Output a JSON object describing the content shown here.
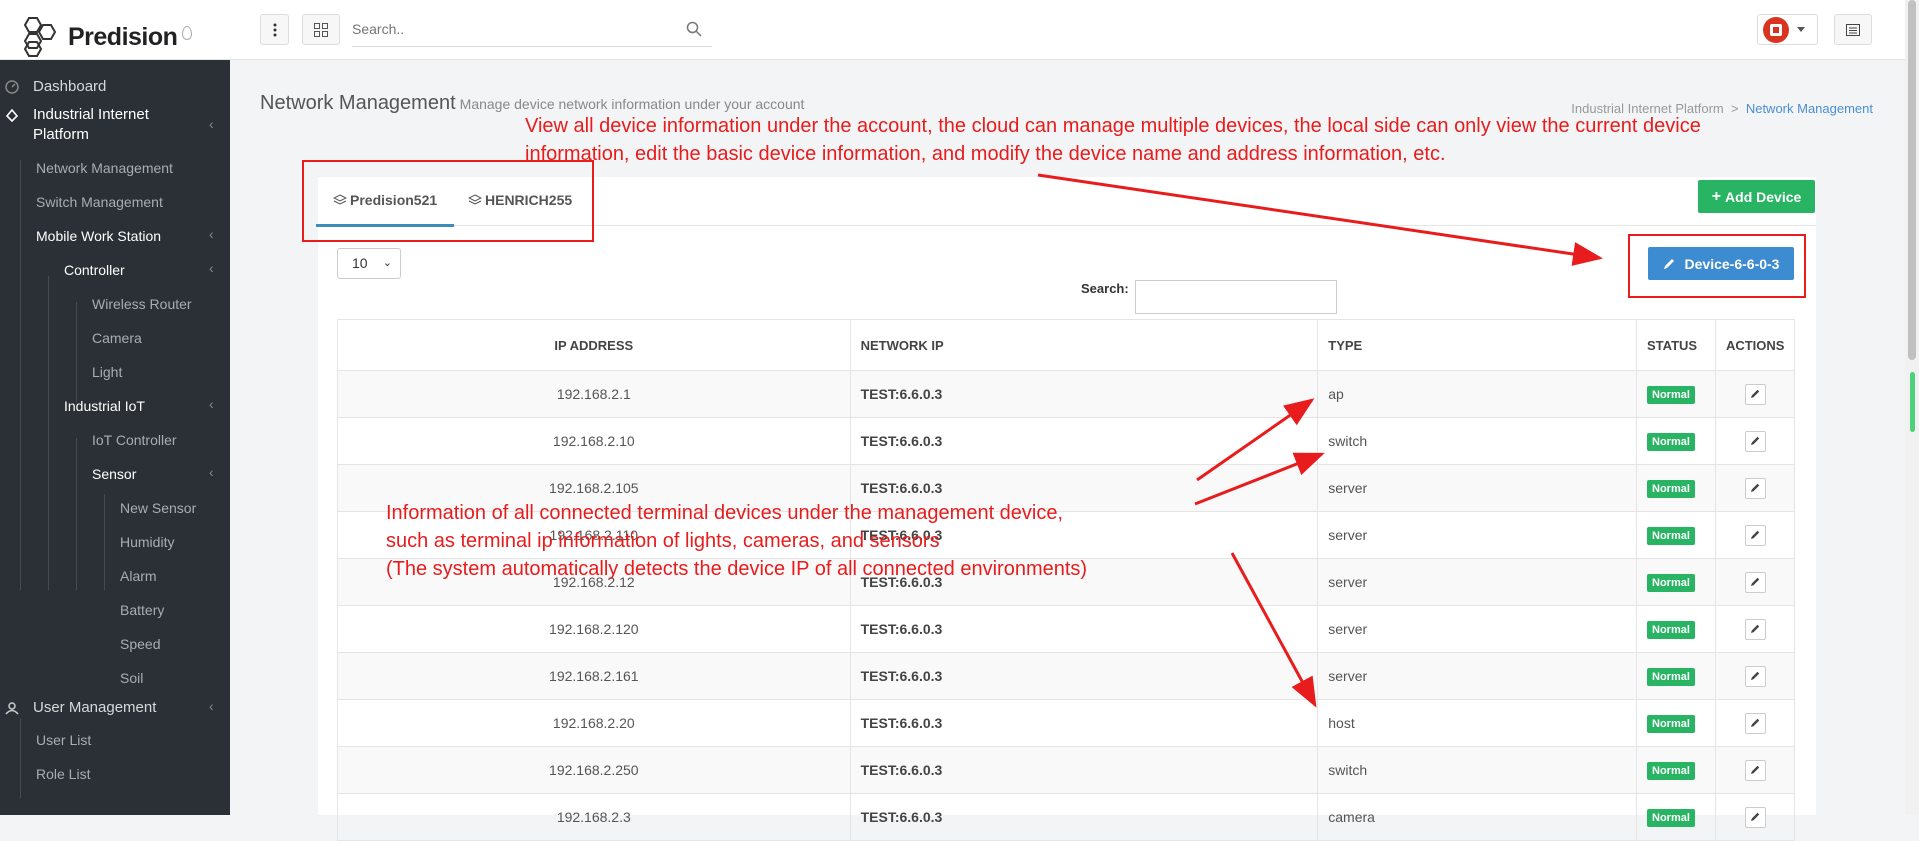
{
  "brand": {
    "name": "Predision"
  },
  "topbar": {
    "search_placeholder": "Search.."
  },
  "sidebar": {
    "dashboard": "Dashboard",
    "industrial_internet": "Industrial Internet Platform",
    "industrial_internet_line1": "Industrial Internet",
    "industrial_internet_line2": "Platform",
    "network_management": "Network Management",
    "switch_management": "Switch Management",
    "mobile_work_station": "Mobile Work Station",
    "controller": "Controller",
    "wireless_router": "Wireless Router",
    "camera": "Camera",
    "light": "Light",
    "industrial_iot": "Industrial IoT",
    "iot_controller": "IoT Controller",
    "sensor": "Sensor",
    "new_sensor": "New Sensor",
    "humidity": "Humidity",
    "alarm": "Alarm",
    "battery": "Battery",
    "speed": "Speed",
    "soil": "Soil",
    "user_management": "User Management",
    "user_list": "User List",
    "role_list": "Role List"
  },
  "page": {
    "title": "Network Management",
    "subtitle": "Manage device network information under your account",
    "breadcrumb_parent": "Industrial Internet Platform",
    "breadcrumb_sep": ">",
    "breadcrumb_current": "Network Management"
  },
  "tabs": [
    {
      "label": "Predision521"
    },
    {
      "label": "HENRICH255"
    }
  ],
  "buttons": {
    "add_device": "Add Device",
    "device": "Device-6-6-0-3"
  },
  "table": {
    "length_value": "10",
    "search_label": "Search:",
    "columns": [
      "IP ADDRESS",
      "NETWORK IP",
      "TYPE",
      "STATUS",
      "ACTIONS"
    ],
    "rows": [
      {
        "ip": "192.168.2.1",
        "network_ip": "TEST:6.6.0.3",
        "type": "ap",
        "status": "Normal"
      },
      {
        "ip": "192.168.2.10",
        "network_ip": "TEST:6.6.0.3",
        "type": "switch",
        "status": "Normal"
      },
      {
        "ip": "192.168.2.105",
        "network_ip": "TEST:6.6.0.3",
        "type": "server",
        "status": "Normal"
      },
      {
        "ip": "192.168.2.110",
        "network_ip": "TEST:6.6.0.3",
        "type": "server",
        "status": "Normal"
      },
      {
        "ip": "192.168.2.12",
        "network_ip": "TEST:6.6.0.3",
        "type": "server",
        "status": "Normal"
      },
      {
        "ip": "192.168.2.120",
        "network_ip": "TEST:6.6.0.3",
        "type": "server",
        "status": "Normal"
      },
      {
        "ip": "192.168.2.161",
        "network_ip": "TEST:6.6.0.3",
        "type": "server",
        "status": "Normal"
      },
      {
        "ip": "192.168.2.20",
        "network_ip": "TEST:6.6.0.3",
        "type": "host",
        "status": "Normal"
      },
      {
        "ip": "192.168.2.250",
        "network_ip": "TEST:6.6.0.3",
        "type": "switch",
        "status": "Normal"
      },
      {
        "ip": "192.168.2.3",
        "network_ip": "TEST:6.6.0.3",
        "type": "camera",
        "status": "Normal"
      }
    ]
  },
  "annotations": {
    "top_line1": "View all device information under the account, the cloud can manage multiple devices, the local side can only view the current device",
    "top_line2": "information, edit the basic device information, and modify the device name and address information, etc.",
    "mid_line1": "Information of all connected terminal devices under the management device,",
    "mid_line2": "such as terminal ip information of lights, cameras, and sensors",
    "mid_line3": "(The system automatically detects the device IP of all connected environments)"
  },
  "colors": {
    "annotation": "#e81c1c",
    "sidebar_bg": "#2b3036",
    "status_green": "#28b463",
    "primary_blue": "#3d8bd1"
  },
  "icons": [
    "menu-dots-icon",
    "grid-icon",
    "search-icon",
    "user-avatar-icon",
    "settings-panel-icon",
    "dashboard-icon",
    "industrial-icon",
    "user-icon",
    "layers-icon",
    "plus-icon",
    "pencil-icon"
  ]
}
